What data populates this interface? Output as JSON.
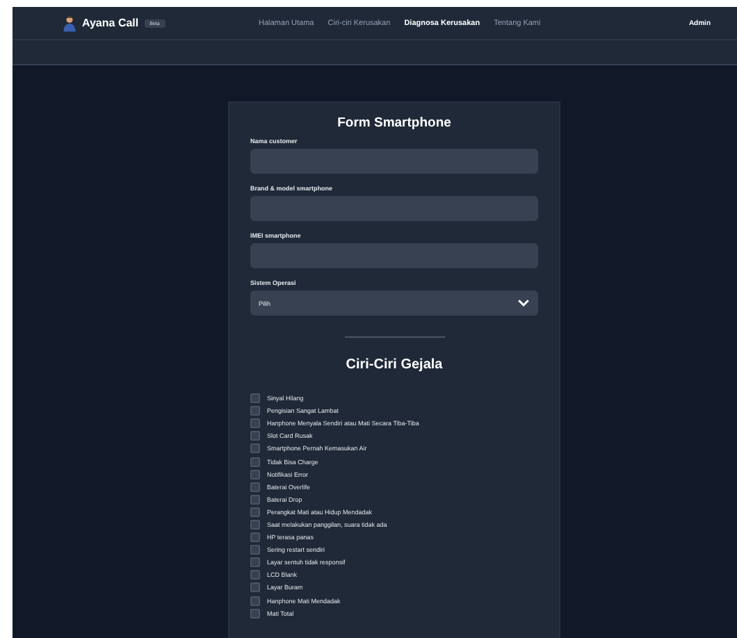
{
  "header": {
    "brand": "Ayana Call",
    "badge": "Beta",
    "nav": [
      {
        "label": "Halaman Utama",
        "selected": false
      },
      {
        "label": "Ciri-ciri Kerusakan",
        "selected": false
      },
      {
        "label": "Diagnosa Kerusakan",
        "selected": true
      },
      {
        "label": "Tentang Kami",
        "selected": false
      }
    ],
    "user": "Admin"
  },
  "form": {
    "title": "Form Smartphone",
    "fields": [
      {
        "label": "Nama customer",
        "kind": "input"
      },
      {
        "label": "Brand & model smartphone",
        "kind": "input"
      },
      {
        "label": "IMEI smartphone",
        "kind": "input"
      },
      {
        "label": "Sistem Operasi",
        "kind": "select",
        "value": "Pilih"
      }
    ]
  },
  "symptoms": {
    "title": "Ciri-Ciri Gejala",
    "items": [
      {
        "label": "Sinyal Hilang",
        "checked": false
      },
      {
        "label": "Pengisian Sangat Lambat",
        "checked": false
      },
      {
        "label": "Hanphone Menyala Sendiri atau Mati Secara Tiba-Tiba",
        "checked": false
      },
      {
        "label": "Slot Card Rusak",
        "checked": false
      },
      {
        "label": "Smartphone Pernah Kemasukan Air",
        "checked": false
      },
      {
        "label": "Tidak Bisa Charge",
        "checked": false
      },
      {
        "label": "Notifikasi Error",
        "checked": false
      },
      {
        "label": "Baterai Overlife",
        "checked": false
      },
      {
        "label": "Baterai Drop",
        "checked": false
      },
      {
        "label": "Perangkat Mati atau Hidup Mendadak",
        "checked": false
      },
      {
        "label": "Saat melakukan panggilan, suara tidak ada",
        "checked": false
      },
      {
        "label": "HP terasa panas",
        "checked": false
      },
      {
        "label": "Sering restart sendiri",
        "checked": false
      },
      {
        "label": "Layar sentuh tidak responsif",
        "checked": false
      },
      {
        "label": "LCD Blank",
        "checked": false
      },
      {
        "label": "Layar Buram",
        "checked": false
      },
      {
        "label": "Hanphone Mati Mendadak",
        "checked": false
      },
      {
        "label": "Mati Total",
        "checked": false
      }
    ]
  }
}
